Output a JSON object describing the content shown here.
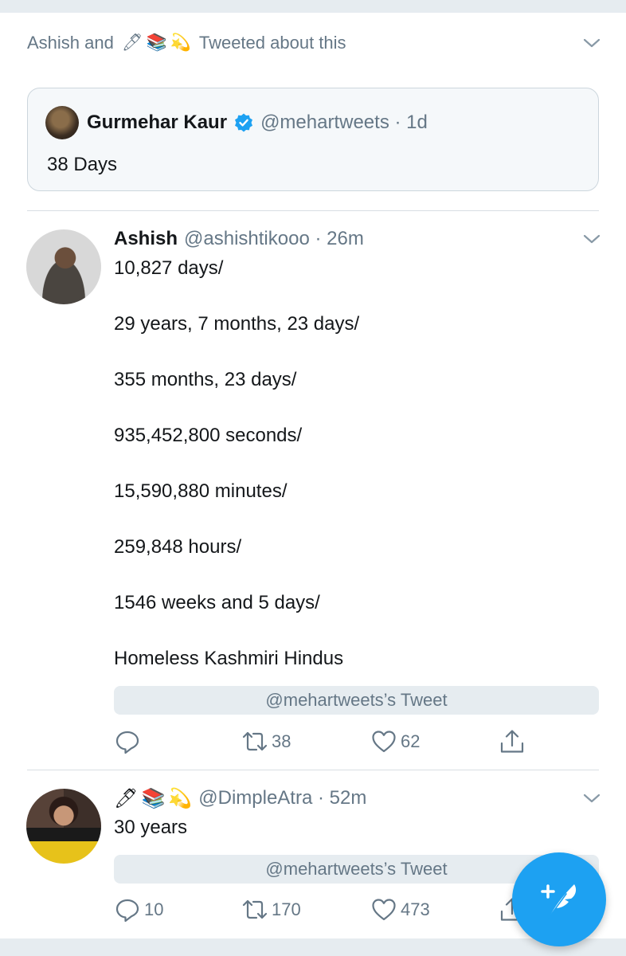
{
  "social_context": {
    "prefix": "Ashish and",
    "emojis": [
      "🖊",
      "📚",
      "💫"
    ],
    "suffix": "Tweeted about this"
  },
  "quoted_tweet": {
    "name": "Gurmehar Kaur",
    "handle_time": "@mehartweets · 1d",
    "text": "38 Days"
  },
  "tweets": [
    {
      "name": "Ashish",
      "handle_time": "@ashishtikooo · 26m",
      "lines": [
        "10,827 days/",
        "29 years, 7 months, 23 days/",
        "355 months, 23 days/",
        "935,452,800 seconds/",
        "15,590,880 minutes/",
        "259,848 hours/",
        "1546 weeks and 5 days/",
        "Homeless Kashmiri Hindus"
      ],
      "quote_pill": "@mehartweets’s Tweet",
      "replies": "",
      "retweets": "38",
      "likes": "62"
    },
    {
      "name_emojis": [
        "🖊",
        "📚",
        "💫"
      ],
      "handle_time": "@DimpleAtra · 52m",
      "text": "30 years",
      "quote_pill": "@mehartweets’s Tweet",
      "replies": "10",
      "retweets": "170",
      "likes": "473"
    }
  ],
  "icons": {
    "caret": "chevron-down-icon",
    "verified": "verified-badge-icon",
    "reply": "reply-icon",
    "retweet": "retweet-icon",
    "like": "heart-icon",
    "share": "share-icon",
    "compose": "compose-tweet-icon"
  },
  "colors": {
    "accent": "#1da1f2",
    "secondary_text": "#657786",
    "primary_text": "#14171a",
    "pill_bg": "#e6ecf0"
  }
}
